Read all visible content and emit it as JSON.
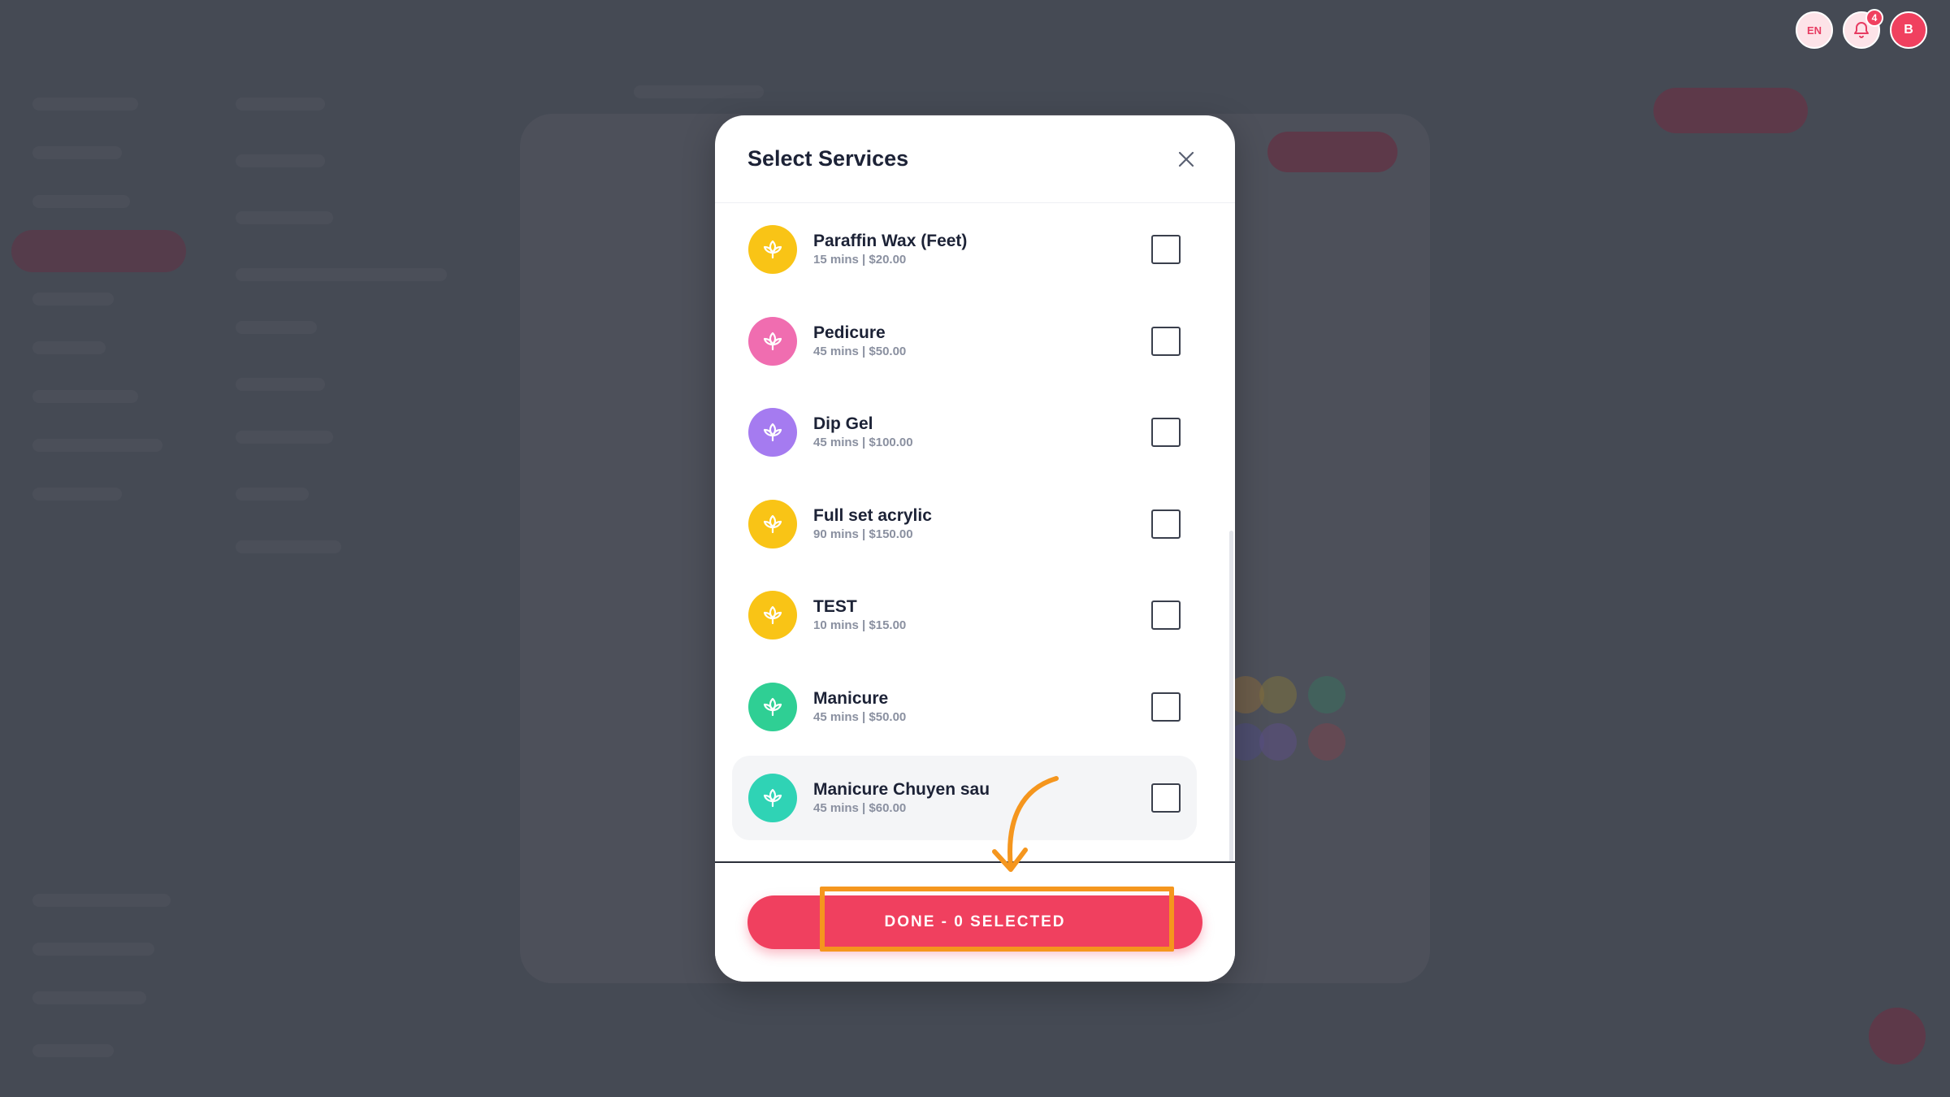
{
  "header": {
    "language": "EN",
    "notification_count": "4",
    "user_initial": "B"
  },
  "modal": {
    "title": "Select Services",
    "services": [
      {
        "name": "Paraffin Wax (Feet)",
        "meta": "15 mins | $20.00",
        "color": "#f9c416",
        "checked": false
      },
      {
        "name": "Pedicure",
        "meta": "45 mins | $50.00",
        "color": "#f06db0",
        "checked": false
      },
      {
        "name": "Dip Gel",
        "meta": "45 mins | $100.00",
        "color": "#a57bf0",
        "checked": false
      },
      {
        "name": "Full set acrylic",
        "meta": "90 mins | $150.00",
        "color": "#f9c416",
        "checked": false
      },
      {
        "name": "TEST",
        "meta": "10 mins | $15.00",
        "color": "#f9c416",
        "checked": false
      },
      {
        "name": "Manicure",
        "meta": "45 mins | $50.00",
        "color": "#2fcf94",
        "checked": false
      },
      {
        "name": "Manicure Chuyen sau",
        "meta": "45 mins | $60.00",
        "color": "#2fd3b5",
        "checked": false
      }
    ],
    "done_label": "DONE - 0 SELECTED",
    "service_icon": "lotus-icon"
  },
  "colors": {
    "accent": "#f0405f",
    "annotation": "#f5961e"
  }
}
